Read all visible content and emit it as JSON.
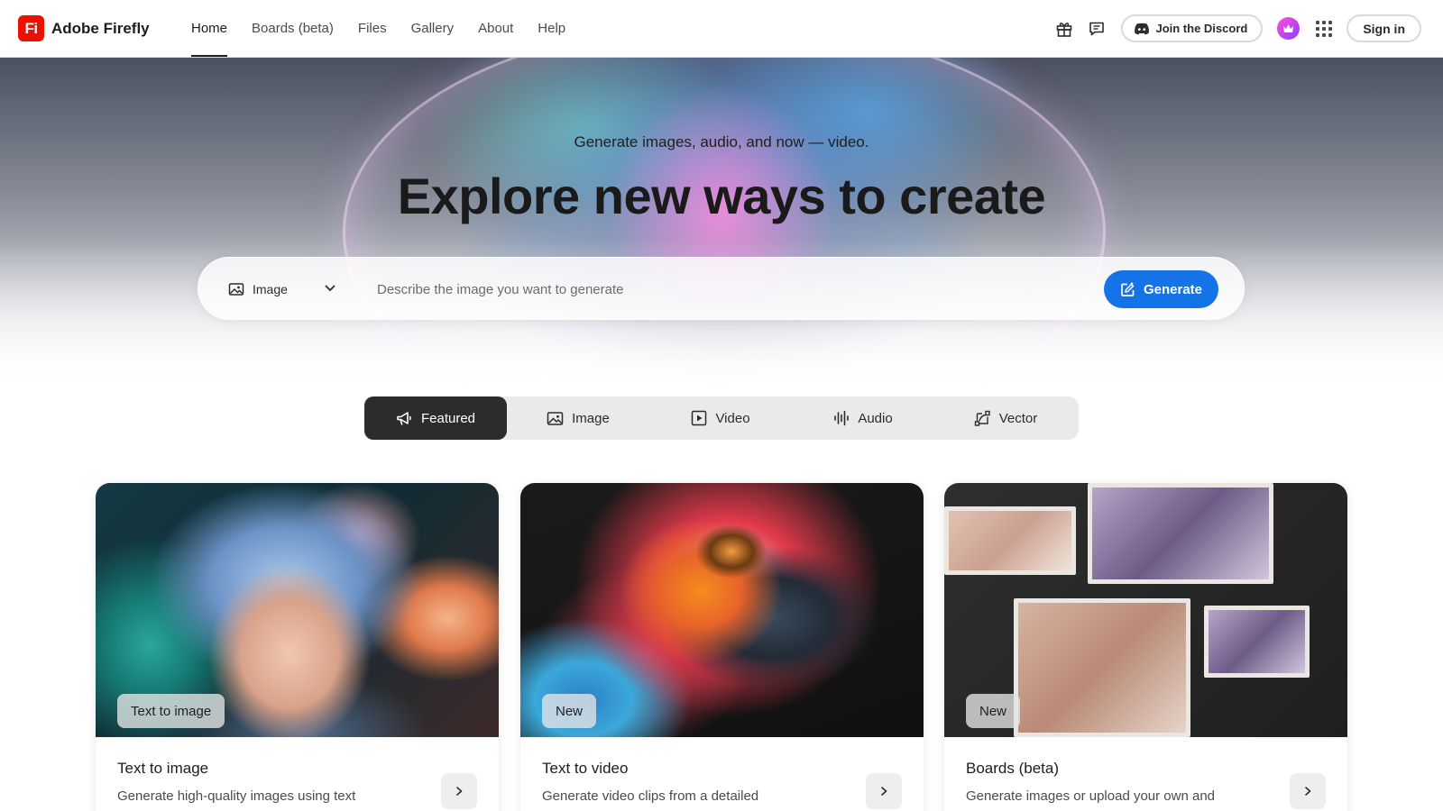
{
  "header": {
    "brand_logo_text": "Fi",
    "brand_name": "Adobe Firefly",
    "nav": [
      {
        "label": "Home",
        "active": true
      },
      {
        "label": "Boards (beta)",
        "active": false
      },
      {
        "label": "Files",
        "active": false
      },
      {
        "label": "Gallery",
        "active": false
      },
      {
        "label": "About",
        "active": false
      },
      {
        "label": "Help",
        "active": false
      }
    ],
    "discord_label": "Join the Discord",
    "signin_label": "Sign in"
  },
  "hero": {
    "subtitle": "Generate images, audio, and now — video.",
    "title": "Explore new ways to create",
    "prompt": {
      "type_selected": "Image",
      "placeholder": "Describe the image you want to generate",
      "value": "",
      "generate_label": "Generate"
    }
  },
  "tabs": [
    {
      "label": "Featured",
      "icon": "megaphone-icon",
      "active": true
    },
    {
      "label": "Image",
      "icon": "image-icon",
      "active": false
    },
    {
      "label": "Video",
      "icon": "video-icon",
      "active": false
    },
    {
      "label": "Audio",
      "icon": "audio-waveform-icon",
      "active": false
    },
    {
      "label": "Vector",
      "icon": "vector-icon",
      "active": false
    }
  ],
  "cards": [
    {
      "badge": "Text to image",
      "title": "Text to image",
      "description": "Generate high-quality images using text"
    },
    {
      "badge": "New",
      "title": "Text to video",
      "description": "Generate video clips from a detailed"
    },
    {
      "badge": "New",
      "title": "Boards (beta)",
      "description": "Generate images or upload your own and"
    }
  ],
  "colors": {
    "accent": "#1473e6",
    "brand": "#eb1000",
    "active_tab": "#2c2c2c"
  }
}
